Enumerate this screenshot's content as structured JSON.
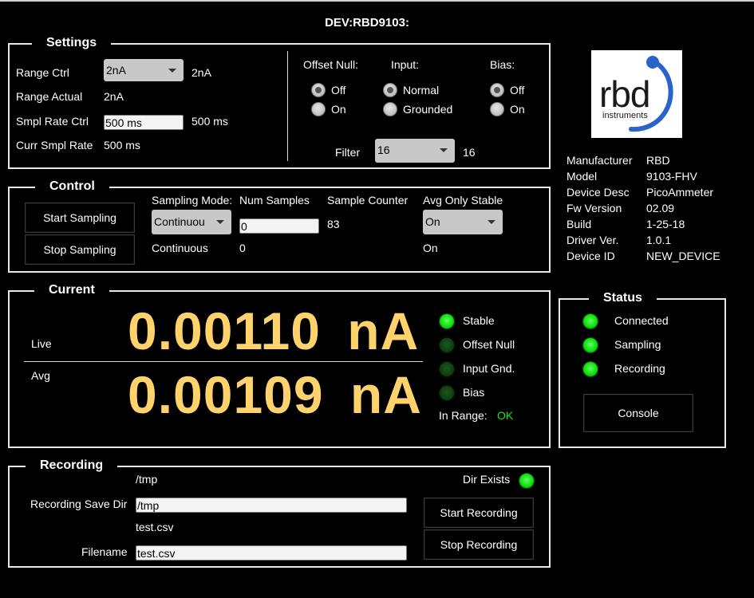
{
  "title": "DEV:RBD9103:",
  "settings": {
    "title": "Settings",
    "range_ctrl_label": "Range Ctrl",
    "range_ctrl_value": "2nA",
    "range_ctrl_readback": "2nA",
    "range_actual_label": "Range Actual",
    "range_actual_value": "2nA",
    "smpl_rate_ctrl_label": "Smpl Rate Ctrl",
    "smpl_rate_ctrl_value": "500 ms",
    "smpl_rate_ctrl_readback": "500 ms",
    "curr_smpl_rate_label": "Curr Smpl Rate",
    "curr_smpl_rate_value": "500 ms",
    "offset_null_label": "Offset Null:",
    "offset_null_options": [
      "Off",
      "On"
    ],
    "offset_null_selected": "Off",
    "input_label": "Input:",
    "input_options": [
      "Normal",
      "Grounded"
    ],
    "input_selected": "Normal",
    "bias_label": "Bias:",
    "bias_options": [
      "Off",
      "On"
    ],
    "bias_selected": "Off",
    "filter_label": "Filter",
    "filter_value": "16",
    "filter_readback": "16"
  },
  "control": {
    "title": "Control",
    "start_sampling": "Start Sampling",
    "stop_sampling": "Stop Sampling",
    "sampling_mode_label": "Sampling Mode:",
    "sampling_mode_value": "Continuou",
    "sampling_mode_readback": "Continuous",
    "num_samples_label": "Num Samples",
    "num_samples_value": "0",
    "num_samples_readback": "0",
    "sample_counter_label": "Sample Counter",
    "sample_counter_value": "83",
    "avg_only_stable_label": "Avg Only Stable",
    "avg_only_stable_value": "On",
    "avg_only_stable_readback": "On"
  },
  "current": {
    "title": "Current",
    "live_label": "Live",
    "live_value": "0.00110",
    "live_unit": "nA",
    "avg_label": "Avg",
    "avg_value": "0.00109",
    "avg_unit": "nA",
    "indicators": [
      {
        "label": "Stable",
        "state": "on"
      },
      {
        "label": "Offset Null",
        "state": "off"
      },
      {
        "label": "Input Gnd.",
        "state": "off"
      },
      {
        "label": "Bias",
        "state": "off"
      }
    ],
    "in_range_label": "In Range:",
    "in_range_value": "OK"
  },
  "device_info": {
    "logo_text": "rbd",
    "logo_subtext": "instruments",
    "rows": [
      {
        "label": "Manufacturer",
        "value": "RBD"
      },
      {
        "label": "Model",
        "value": "9103-FHV"
      },
      {
        "label": "Device Desc",
        "value": "PicoAmmeter"
      },
      {
        "label": "Fw Version",
        "value": "02.09"
      },
      {
        "label": "Build",
        "value": "1-25-18"
      },
      {
        "label": "Driver Ver.",
        "value": "1.0.1"
      },
      {
        "label": "Device ID",
        "value": "NEW_DEVICE"
      }
    ]
  },
  "status": {
    "title": "Status",
    "indicators": [
      {
        "label": "Connected",
        "state": "on"
      },
      {
        "label": "Sampling",
        "state": "on"
      },
      {
        "label": "Recording",
        "state": "on"
      }
    ],
    "console_button": "Console"
  },
  "recording": {
    "title": "Recording",
    "dir_readback": "/tmp",
    "dir_exists_label": "Dir Exists",
    "save_dir_label": "Recording Save Dir",
    "save_dir_value": "/tmp",
    "filename_readback": "test.csv",
    "filename_label": "Filename",
    "filename_value": "test.csv",
    "start_recording": "Start Recording",
    "stop_recording": "Stop Recording"
  },
  "colors": {
    "background": "#000000",
    "numeric_display": "#ffd26b",
    "led_on": "#12e012",
    "led_off": "#0f3d0f",
    "ok_text": "#1ee21e"
  }
}
